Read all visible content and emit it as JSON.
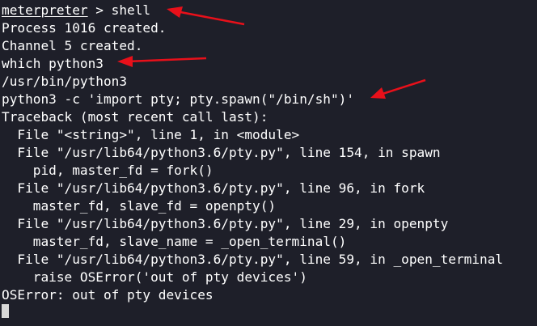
{
  "terminal": {
    "prompt": {
      "name": "meterpreter",
      "sep": " > ",
      "command": "shell"
    },
    "lines": [
      "Process 1016 created.",
      "Channel 5 created.",
      "which python3",
      "/usr/bin/python3",
      "python3 -c 'import pty; pty.spawn(\"/bin/sh\")'",
      "Traceback (most recent call last):",
      "  File \"<string>\", line 1, in <module>",
      "  File \"/usr/lib64/python3.6/pty.py\", line 154, in spawn",
      "    pid, master_fd = fork()",
      "  File \"/usr/lib64/python3.6/pty.py\", line 96, in fork",
      "    master_fd, slave_fd = openpty()",
      "  File \"/usr/lib64/python3.6/pty.py\", line 29, in openpty",
      "    master_fd, slave_name = _open_terminal()",
      "  File \"/usr/lib64/python3.6/pty.py\", line 59, in _open_terminal",
      "    raise OSError('out of pty devices')",
      "OSError: out of pty devices"
    ]
  },
  "colors": {
    "background": "#1e1f29",
    "text": "#ffffff",
    "cursor": "#d8d8d8",
    "arrow": "#e8101a"
  },
  "annotations": {
    "arrow_count": 3,
    "arrow_color": "red"
  }
}
